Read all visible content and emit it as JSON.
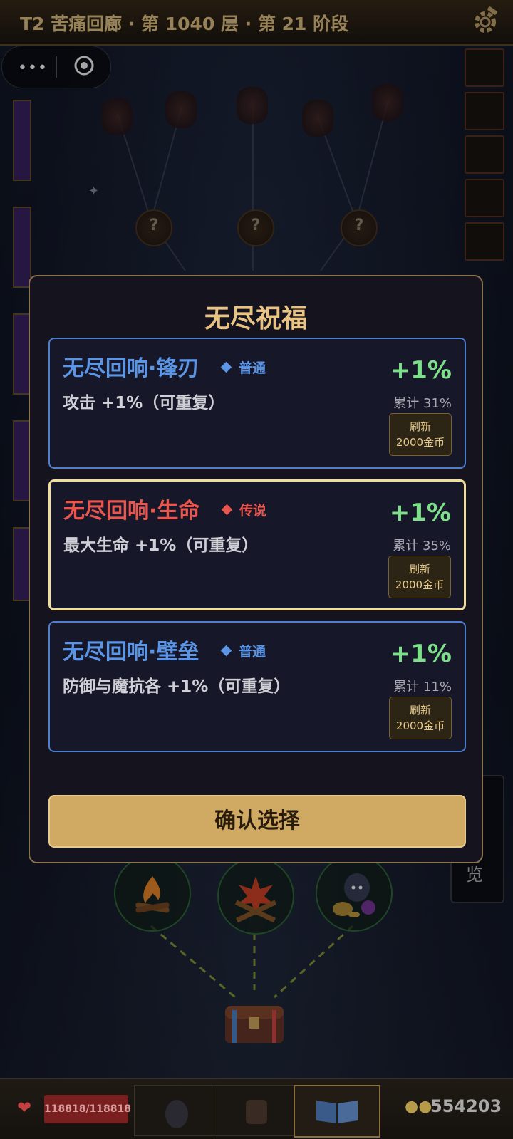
{
  "header": {
    "title": "T2 苦痛回廊 · 第 1040 层 · 第 21 阶段",
    "settings_icon": "gear-icon"
  },
  "capsule": {
    "more_icon": "more-dots-icon",
    "more_glyph": "•••",
    "close_icon": "target-circle-icon"
  },
  "map": {
    "unknown_node_label": "?"
  },
  "modal": {
    "title": "无尽祝福",
    "cards": [
      {
        "name": "无尽回响·锋刃",
        "rarity": "普通",
        "rarity_color": "#5b95e6",
        "name_color": "#5b95e6",
        "desc": "攻击 +1%（可重复）",
        "pct": "+1%",
        "total": "累计 31%",
        "refresh_label": "刷新",
        "refresh_cost": "2000金币",
        "selected": false
      },
      {
        "name": "无尽回响·生命",
        "rarity": "传说",
        "rarity_color": "#e8564e",
        "name_color": "#e8564e",
        "desc": "最大生命 +1%（可重复）",
        "pct": "+1%",
        "total": "累计 35%",
        "refresh_label": "刷新",
        "refresh_cost": "2000金币",
        "selected": true
      },
      {
        "name": "无尽回响·壁垒",
        "rarity": "普通",
        "rarity_color": "#5b95e6",
        "name_color": "#5b95e6",
        "desc": "防御与魔抗各 +1%（可重复）",
        "pct": "+1%",
        "total": "累计 11%",
        "refresh_label": "刷新",
        "refresh_cost": "2000金币",
        "selected": false
      }
    ],
    "confirm_label": "确认选择"
  },
  "side_panel": {
    "label": "览"
  },
  "bottom": {
    "hp_icon": "heart-icon",
    "hp_text": "118818/118818",
    "slots": [
      "hero-icon",
      "backpack-icon",
      "book-icon"
    ],
    "coin_icon": "coins-icon",
    "coins": "554203"
  }
}
